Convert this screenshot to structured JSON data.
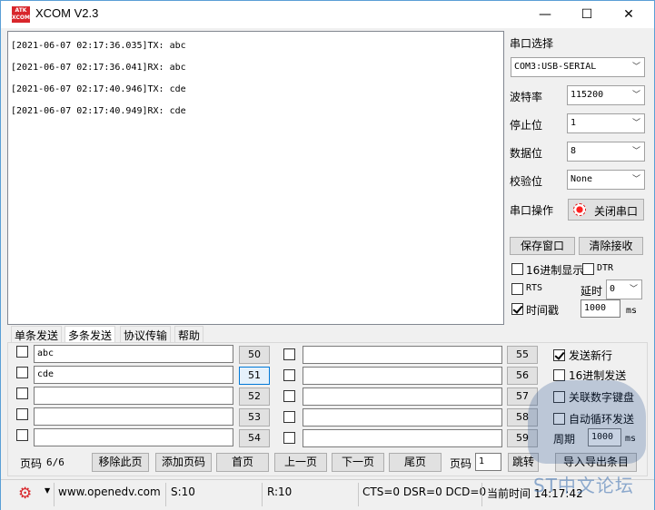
{
  "titlebar": {
    "logo_text": "ATK XCOM",
    "title": "XCOM V2.3",
    "minimize": "—",
    "maximize": "☐",
    "close": "✕"
  },
  "receive": {
    "lines": [
      "[2021-06-07 02:17:36.035]TX: abc",
      "[2021-06-07 02:17:36.041]RX: abc",
      "[2021-06-07 02:17:40.946]TX: cde",
      "[2021-06-07 02:17:40.949]RX: cde"
    ]
  },
  "serial": {
    "port_label": "串口选择",
    "port_value": "COM3:USB-SERIAL",
    "baud_label": "波特率",
    "baud_value": "115200",
    "stop_label": "停止位",
    "stop_value": "1",
    "data_label": "数据位",
    "data_value": "8",
    "parity_label": "校验位",
    "parity_value": "None",
    "op_label": "串口操作",
    "close_port_label": "关闭串口",
    "save_window_label": "保存窗口",
    "clear_recv_label": "清除接收",
    "hex_display_label": "16进制显示",
    "dtr_label": "DTR",
    "rts_label": "RTS",
    "delay_label": "延时",
    "delay_value": "0",
    "timestamp_label": "时间戳",
    "timestamp_value": "1000",
    "timestamp_unit": "ms"
  },
  "tabs": [
    {
      "label": "单条发送"
    },
    {
      "label": "多条发送"
    },
    {
      "label": "协议传输"
    },
    {
      "label": "帮助"
    }
  ],
  "multi_send": {
    "left_rows": [
      {
        "text": "abc",
        "num": "50",
        "checked": false
      },
      {
        "text": "cde",
        "num": "51",
        "checked": false
      },
      {
        "text": "",
        "num": "52",
        "checked": false
      },
      {
        "text": "",
        "num": "53",
        "checked": false
      },
      {
        "text": "",
        "num": "54",
        "checked": false
      }
    ],
    "right_rows": [
      {
        "text": "",
        "num": "55"
      },
      {
        "text": "",
        "num": "56"
      },
      {
        "text": "",
        "num": "57"
      },
      {
        "text": "",
        "num": "58"
      },
      {
        "text": "",
        "num": "59"
      }
    ],
    "options": {
      "send_newline": "发送新行",
      "hex_send": "16进制发送",
      "link_keypad": "关联数字键盘",
      "auto_loop": "自动循环发送",
      "period_label": "周期",
      "period_value": "1000",
      "period_unit": "ms"
    },
    "pager": {
      "page_label": "页码",
      "page_value": "6/6",
      "remove_page": "移除此页",
      "add_page": "添加页码",
      "first_page": "首页",
      "prev_page": "上一页",
      "next_page": "下一页",
      "last_page": "尾页",
      "goto_label": "页码",
      "goto_value": "1",
      "jump": "跳转",
      "import_export": "导入导出条目"
    }
  },
  "status": {
    "url": "www.openedv.com",
    "sent": "S:10",
    "recv": "R:10",
    "lines": "CTS=0 DSR=0 DCD=0",
    "time": "当前时间 14:17:42"
  },
  "watermark": "ST中文论坛"
}
